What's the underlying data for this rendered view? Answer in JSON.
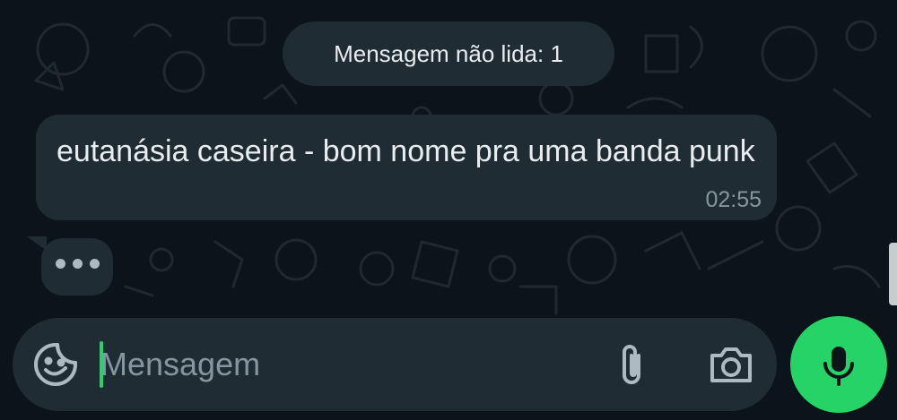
{
  "chat": {
    "unread_banner": "Mensagem não lida: 1",
    "messages": [
      {
        "text": "eutanásia caseira - bom nome pra uma banda punk",
        "time": "02:55"
      }
    ]
  },
  "composer": {
    "placeholder": "Mensagem",
    "icons": {
      "sticker": "sticker-icon",
      "attach": "paperclip-icon",
      "camera": "camera-icon",
      "mic": "microphone-icon"
    }
  },
  "colors": {
    "background": "#0b141a",
    "bubble": "#202c33",
    "accent": "#25d366",
    "text": "#e9edef",
    "muted": "#8696a0"
  }
}
